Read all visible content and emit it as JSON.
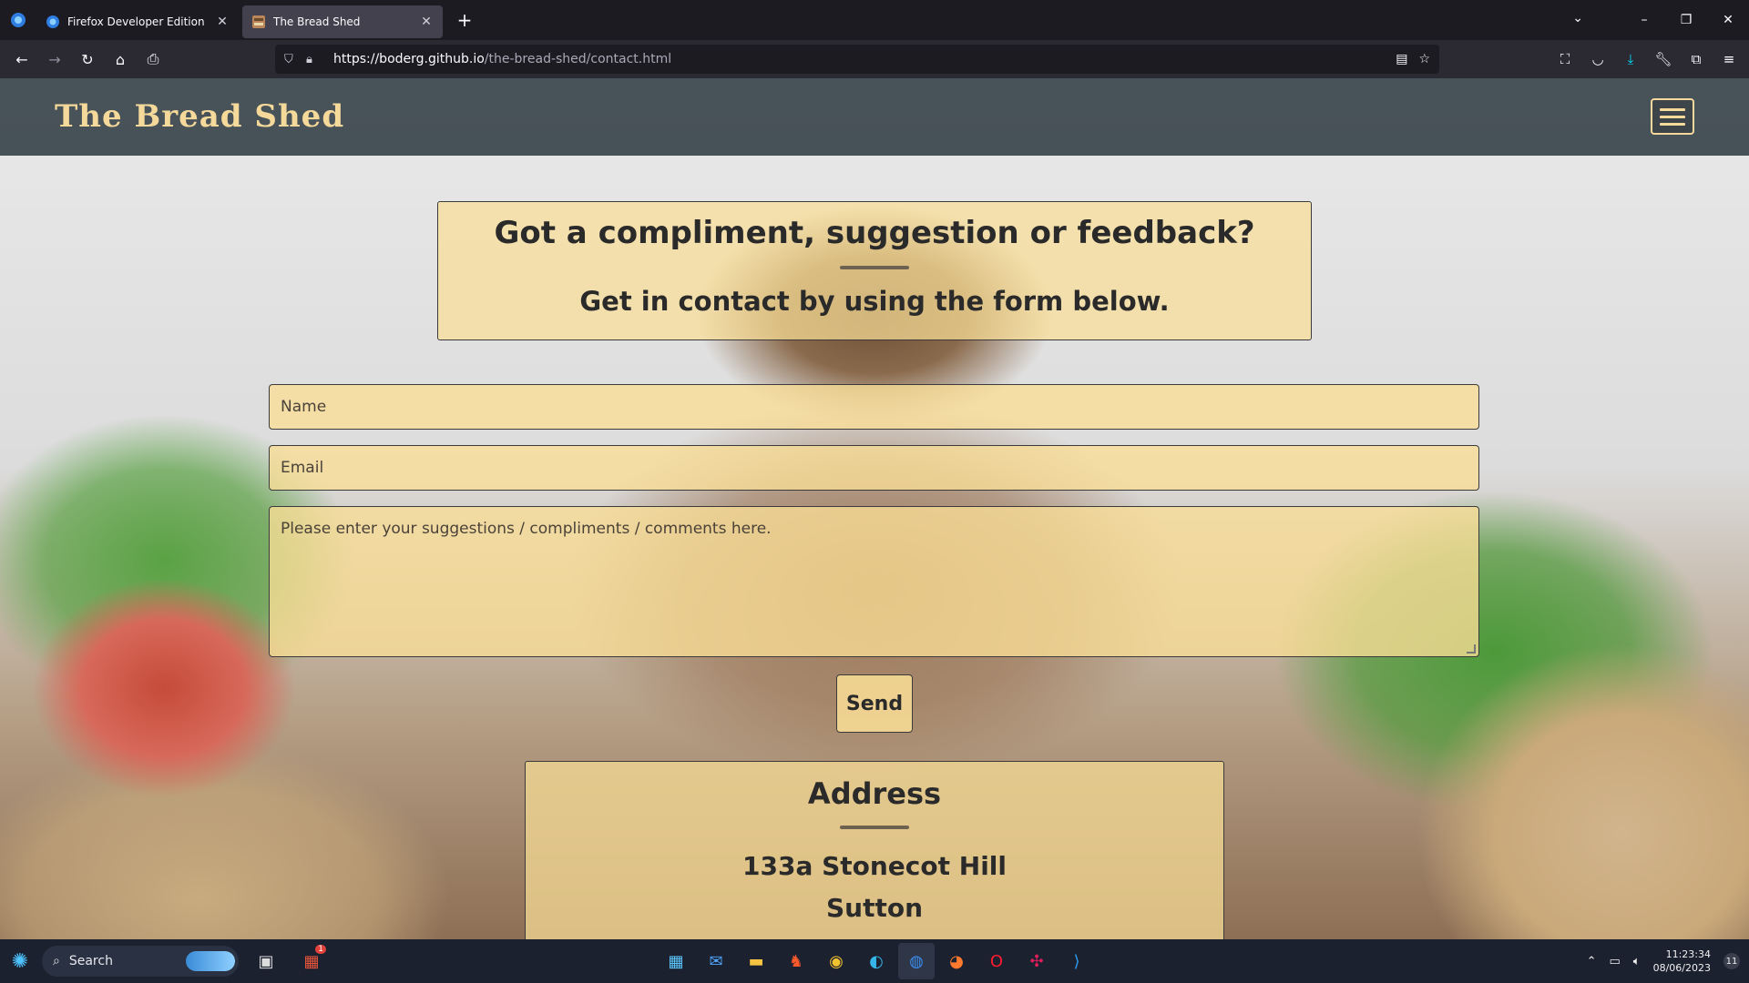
{
  "browser": {
    "tabs": [
      {
        "title": "Firefox Developer Edition",
        "active": false
      },
      {
        "title": "The Bread Shed",
        "active": true
      }
    ],
    "url_host": "https://boderg.github.io",
    "url_path": "/the-bread-shed/contact.html"
  },
  "site": {
    "title": "The Bread Shed",
    "heading": "Got a compliment, suggestion or feedback?",
    "subheading": "Get in contact by using the form below.",
    "form": {
      "name_placeholder": "Name",
      "email_placeholder": "Email",
      "message_placeholder": "Please enter your suggestions / compliments / comments here.",
      "send_label": "Send"
    },
    "address": {
      "heading": "Address",
      "lines": [
        "133a Stonecot Hill",
        "Sutton"
      ]
    }
  },
  "taskbar": {
    "search_label": "Search",
    "time": "11:23:34",
    "date": "08/06/2023",
    "notification_count": "11",
    "widget_badge": "1"
  },
  "colors": {
    "header_bg": "#3a444c",
    "accent": "#f5d99a",
    "panel": "#fade96"
  }
}
